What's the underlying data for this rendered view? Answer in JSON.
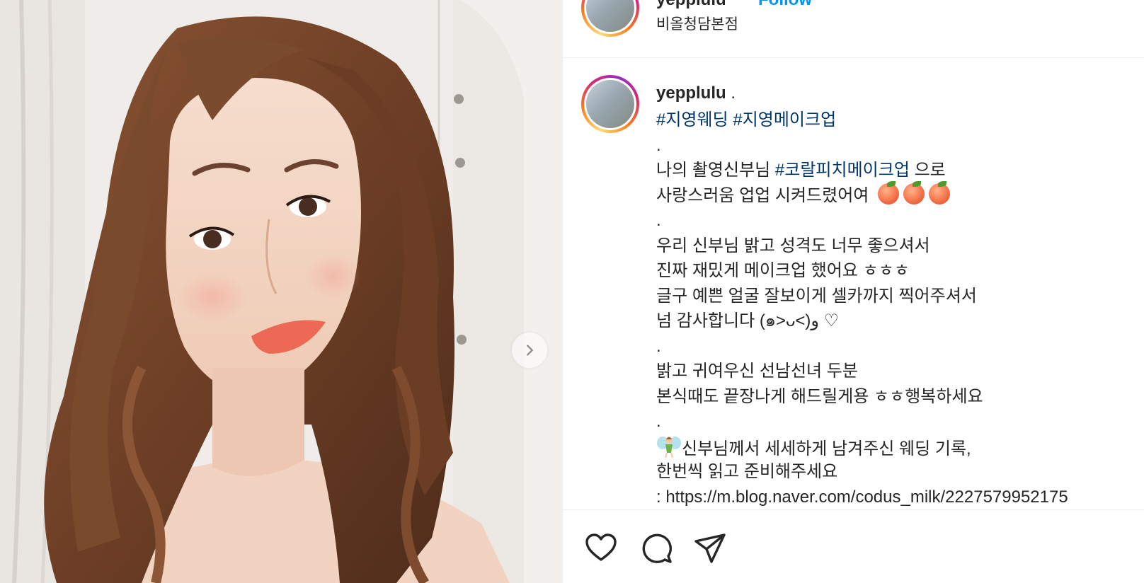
{
  "post": {
    "username": "yepplulu",
    "follow_label": "Follow",
    "location": "비올청담본점"
  },
  "caption": {
    "username": "yepplulu",
    "separator": ".",
    "hashtag_1": "#지영웨딩",
    "hashtag_2": "#지영메이크업",
    "lines": {
      "l1": ".",
      "l2_pre": "나의 촬영신부님 ",
      "l2_tag": "#코랄피치메이크업",
      "l2_post": " 으로",
      "l3": "사랑스러움 업업 시켜드렸어여",
      "l4": ".",
      "l5": "우리 신부님 밝고 성격도 너무 좋으셔서",
      "l6": "진짜 재밌게 메이크업 했어요 ㅎㅎㅎ",
      "l7": "글구 예쁜 얼굴 잘보이게 셀카까지 찍어주셔서",
      "l8": "넘 감사합니다 (๑˃ᴗ˂)ﻭ ♡",
      "l9": ".",
      "l10": "밝고 귀여우신 선남선녀 두분",
      "l11": "본식때도 끝장나게 해드릴게용 ㅎㅎ행복하세요",
      "l12": ".",
      "l13": "신부님께서 세세하게 남겨주신 웨딩 기록,",
      "l14": "한번씩 읽고 준비해주세요",
      "l15": ": https://m.blog.naver.com/codus_milk/2227579952175"
    }
  },
  "icons": {
    "like": "heart-icon",
    "comment": "comment-icon",
    "share": "share-icon",
    "next": "chevron-right-icon"
  },
  "colors": {
    "link": "#00376b",
    "follow": "#0095f6",
    "text": "#262626",
    "divider": "#efefef"
  }
}
